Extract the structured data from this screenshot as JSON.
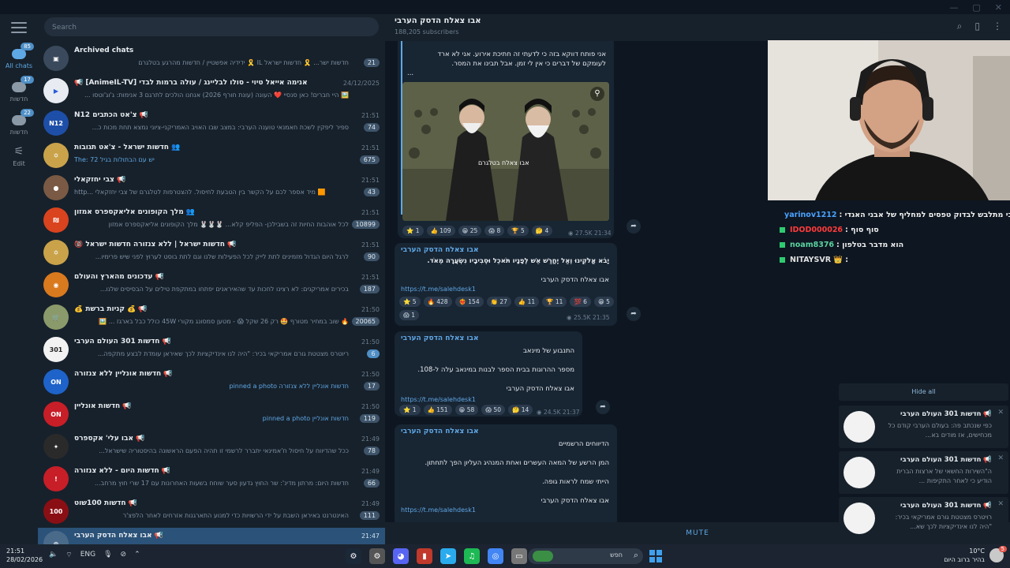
{
  "rail": {
    "folders": [
      {
        "label": "All chats",
        "badge": "85"
      },
      {
        "label": "חדשות",
        "badge": "17"
      },
      {
        "label": "חדשות",
        "badge": "22"
      },
      {
        "label": "Edit",
        "badge": ""
      }
    ]
  },
  "search": {
    "placeholder": "Search"
  },
  "chats": [
    {
      "name": "Archived chats",
      "preview": "חדשות ישר... 🎗️ חדשות ישראל IL 🎗️ ידידיה אפשטיין / חדשות מהרגע בטלגרם",
      "time": "",
      "unread": "21"
    },
    {
      "name": "📢 [AnimeIL-TV] אנימה אייאל טיוי - סולו לבליינג / עולה ברמות לבדי",
      "preview": "🖼️ היי חברים! כאן סנסיי ❤️ העונה (עונת חורף 2026) אנחנו הולכים לתרגם 3 אנימות: ג'וג'וטסו ...",
      "time": "24/12/2025",
      "unread": ""
    },
    {
      "name": "📢 צ'אט הכתבים N12",
      "preview": "ספיר ליפקין לשכת חאמנאי טוענה הערבי: במצב שבו האויב האמריקני-ציוני נמצא תחת מכות כ...",
      "time": "21:51",
      "unread": "74"
    },
    {
      "name": "👥 חדשות ישראל - צ'אט תגובות",
      "preview": "The: יש עם הבתולות בגיל 72",
      "time": "21:51",
      "unread": "675"
    },
    {
      "name": "📢 צבי יחזקאלי",
      "preview": "http... מיד אספר לכם על הקשר בין הטבעת לחיסול. להצטרפות לטלגרם של צבי יחזקאלי 🟧",
      "time": "21:51",
      "unread": "43"
    },
    {
      "name": "👥 מלך הקופונים אליאקספרס אמזון",
      "preview": "לכל אוהבות החיות זה בשבילכן- הפליפ קלא... 🐰🐰🐰 מלך הקופונים אליאקספרס אמזון",
      "time": "21:51",
      "unread": "10899"
    },
    {
      "name": "📢 חדשות ישראל | ללא צנזורה חדשות ישראל 🔞",
      "preview": "לרגל היום הגדול מזמינים לתת לייק לכל הפעילות שלנו וגם לתת בוסט לערוץ לפני שיש פרימיו...",
      "time": "21:51",
      "unread": "90"
    },
    {
      "name": "📢 עדכונים מהארץ והעולם",
      "preview": "בכירים אמריקנים: לא רצינו לחכות עד שהאיראנים יפתחו במתקפת טילים על הבסיסים שלנו...",
      "time": "21:51",
      "unread": "187"
    },
    {
      "name": "📢 💰 קניות ברשת 💰",
      "preview": "🔥 שוב במחיר מטורף 🤩 רק 26 שקל 😱 - מטען סמסונג מקורי 45W כולל כבל בארגז ... 🖼️",
      "time": "21:50",
      "unread": "20065"
    },
    {
      "name": "📢 חדשות 301 העולם הערבי",
      "preview": "ריוטרס מצטטת גורם אמריקאי בכיר: \"היה לנו אינדיקציות לכך שאיראן עומדת לבצע מתקפה...",
      "time": "21:50",
      "unread": "6"
    },
    {
      "name": "📢 חדשות אונליין ללא צנזורה",
      "preview": "חדשות אונליין ללא צנזורה pinned a photo",
      "time": "21:50",
      "unread": "17"
    },
    {
      "name": "📢 חדשות אונליין",
      "preview": "חדשות אונליין pinned a photo",
      "time": "21:50",
      "unread": "119"
    },
    {
      "name": "📢 אבו עלי' אקספרס",
      "preview": "ככל שהדיווח על חיסול ח'אמינאי יתברר לרשמי זו תהיה הפעם הראשונה בהיסטוריה שישראל...",
      "time": "21:49",
      "unread": "78"
    },
    {
      "name": "📢 חדשות היום - ללא צנזורה",
      "preview": "חדשות היום: מרתון מדינ': שר החוץ גדעון סער שוחח בשעות האחרונות עם 17 שרי חוץ מרחב...",
      "time": "21:49",
      "unread": "66"
    },
    {
      "name": "📢 חדשות 100שוט",
      "preview": "האינטרנט באיראן השבת על ידי הרשויות כדי למנוע התארגנות אזרחים לאחר הלפצ'ר",
      "time": "21:49",
      "unread": "111"
    },
    {
      "name": "📢 אבו צאלח הדסק הערבי",
      "preview": "",
      "time": "21:47",
      "unread": ""
    }
  ],
  "channel": {
    "title": "אבו צאלח הדסק הערבי",
    "subscribers": "188,205 subscribers"
  },
  "messages": [
    {
      "author": "אבו צאלח הדסק הערבי",
      "lines": [
        "אני פותח דווקא בזה כי לדעתי זה חתיכת אירוע. אני לא ארד",
        "לעומקם של דברים כי אין לי זמן. אבל תבינו את המסר.",
        "..."
      ],
      "photo_caption": "אבו צאלח בטלגרם",
      "reactions": [
        "⭐ 1",
        "👍 109",
        "😁 25",
        "😱 8",
        "🏆 5",
        "🤔 4"
      ],
      "views": "27.5K",
      "time": "21:34"
    },
    {
      "author": "אבו צאלח הדסק הערבי",
      "lines": [
        "יָבֹא אֱלֹקֵינוּ וְאַל יֶחֱרַשׁ אֵשׁ לְפָנָיו תֹּאכֵל וּסְבִיבָיו נִשְׂעֲרָה מְאֹד.",
        "אבו צאלח הדסק הערבי"
      ],
      "link": "https://t.me/salehdesk1",
      "reactions": [
        "⭐ 5",
        "🔥 428",
        "❤️‍🔥 154",
        "👏 27",
        "👍 11",
        "🏆 11",
        "💯 6",
        "😁 5",
        "😱 1"
      ],
      "views": "25.5K",
      "time": "21:35"
    },
    {
      "author": "אבו צאלח הדסק הערבי",
      "lines": [
        "התנבוע של מינאב",
        "מספר ההרוגות בבית הספר לבנות במינאב עלה ל-108.",
        "אבו צאלח הדסק הערבי"
      ],
      "link": "https://t.me/salehdesk1",
      "reactions": [
        "⭐ 1",
        "👍 151",
        "😁 58",
        "😱 50",
        "🤔 14"
      ],
      "views": "24.5K",
      "time": "21:37"
    },
    {
      "author": "אבו צאלח הדסק הערבי",
      "lines": [
        "הדיווחים הרשמיים",
        "המן הרשע של המאה העשרים ואחת המנהיג העליון הפך לתחתון.",
        "הייתי שמח לראות גופה.",
        "אבו צאלח הדסק הערבי"
      ],
      "link": "https://t.me/salehdesk1",
      "reactions": [],
      "views": "",
      "time": ""
    }
  ],
  "footer": {
    "mute_label": "MUTE"
  },
  "stream_chat": [
    {
      "user": "yarinov1212",
      "color": "#4aa3ff",
      "text": "הכי מתלבש לבדוק טפסים למחליף של אבני האגדי :"
    },
    {
      "user": "IDOD000026",
      "color": "#ff3b3b",
      "text": "סוף סוף :"
    },
    {
      "user": "noam8376",
      "color": "#5ad3a0",
      "text": "הוא מדבר בטלפון :"
    },
    {
      "user": "NITAYSVR",
      "color": "#e0e0e0",
      "text": "👑 :"
    }
  ],
  "notifications": {
    "hide_all": "Hide all",
    "items": [
      {
        "title": "📢 חדשות 301 העולם הערבי",
        "text": "כפי שנכתב פה: בעולם הערבי קודם כל מכחישים, אז מודים בא..."
      },
      {
        "title": "📢 חדשות 301 העולם הערבי",
        "text": "ה\"השירות החשאי של ארצות הברית הודיע כי לאחר התקיפות ..."
      },
      {
        "title": "📢 חדשות 301 העולם הערבי",
        "text": "רויטרס מצטטת גורם אמריקאי בכיר: \"היה לנו אינדיקציות לכך שא..."
      }
    ]
  },
  "taskbar": {
    "time": "21:51",
    "date": "28/02/2026",
    "lang": "ENG",
    "search_label": "חפש",
    "weather_temp": "10°C",
    "weather_desc": "בהיר ברוב היום",
    "notif_count": "5"
  }
}
